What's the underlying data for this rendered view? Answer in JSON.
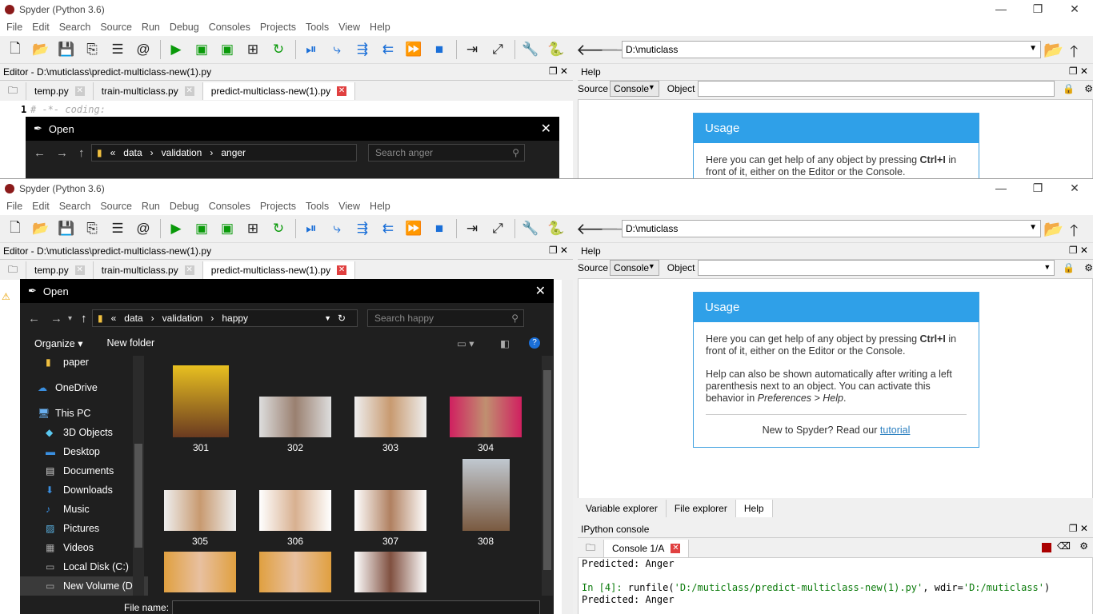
{
  "app_title": "Spyder (Python 3.6)",
  "menu": [
    "File",
    "Edit",
    "Search",
    "Source",
    "Run",
    "Debug",
    "Consoles",
    "Projects",
    "Tools",
    "View",
    "Help"
  ],
  "path": "D:\\muticlass",
  "editor": {
    "title": "Editor - D:\\muticlass\\predict-multiclass-new(1).py",
    "tabs": [
      "temp.py",
      "train-multiclass.py",
      "predict-multiclass-new(1).py"
    ],
    "line1_code": "# -*- coding:"
  },
  "help_pane": {
    "title": "Help",
    "source_label": "Source",
    "source_value": "Console",
    "object_label": "Object",
    "usage_title": "Usage",
    "p1_a": "Here you can get help of any object by pressing ",
    "p1_key": "Ctrl+I",
    "p1_b": " in front of it, either on the Editor or the Console.",
    "p2_a": "Help can also be shown automatically after writing a left parenthesis next to an object. You can activate this behavior in ",
    "p2_em": "Preferences > Help",
    "p2_b": ".",
    "new_a": "New to Spyder? Read our ",
    "new_link": "tutorial",
    "bottom_tabs": [
      "Variable explorer",
      "File explorer",
      "Help"
    ]
  },
  "ipython": {
    "title": "IPython console",
    "tab": "Console 1/A",
    "lines": {
      "l1": "Predicted: Anger",
      "prompt": "In [4]: ",
      "cmd_a": "runfile(",
      "cmd_path": "'D:/muticlass/predict-multiclass-new(1).py'",
      "cmd_b": ", wdir=",
      "cmd_wdir": "'D:/muticlass'",
      "cmd_c": ")",
      "l2": "Predicted: Anger"
    }
  },
  "dialog_top": {
    "title": "Open",
    "crumbs": [
      "«",
      "data",
      "›",
      "validation",
      "›",
      "anger"
    ],
    "search": "Search anger"
  },
  "dialog": {
    "title": "Open",
    "crumbs": [
      "«",
      "data",
      "›",
      "validation",
      "›",
      "happy"
    ],
    "search": "Search happy",
    "organize": "Organize ▾",
    "new_folder": "New folder",
    "nav": [
      {
        "label": "paper",
        "icon": "folder-icon"
      },
      {
        "label": "OneDrive",
        "icon": "cloud-icon"
      },
      {
        "label": "This PC",
        "icon": "computer-icon"
      },
      {
        "label": "3D Objects",
        "icon": "cube-icon"
      },
      {
        "label": "Desktop",
        "icon": "desktop-icon"
      },
      {
        "label": "Documents",
        "icon": "document-icon"
      },
      {
        "label": "Downloads",
        "icon": "download-icon"
      },
      {
        "label": "Music",
        "icon": "music-icon"
      },
      {
        "label": "Pictures",
        "icon": "pictures-icon"
      },
      {
        "label": "Videos",
        "icon": "video-icon"
      },
      {
        "label": "Local Disk (C:)",
        "icon": "disk-icon"
      },
      {
        "label": "New Volume (D:",
        "icon": "disk-icon"
      }
    ],
    "files": [
      "301",
      "302",
      "303",
      "304",
      "305",
      "306",
      "307",
      "308",
      "",
      "",
      ""
    ],
    "filename_label": "File name:"
  },
  "colors": {
    "accent": "#2fa0e8",
    "dialog_bg": "#1f1f1f",
    "close_red": "#e04040"
  }
}
